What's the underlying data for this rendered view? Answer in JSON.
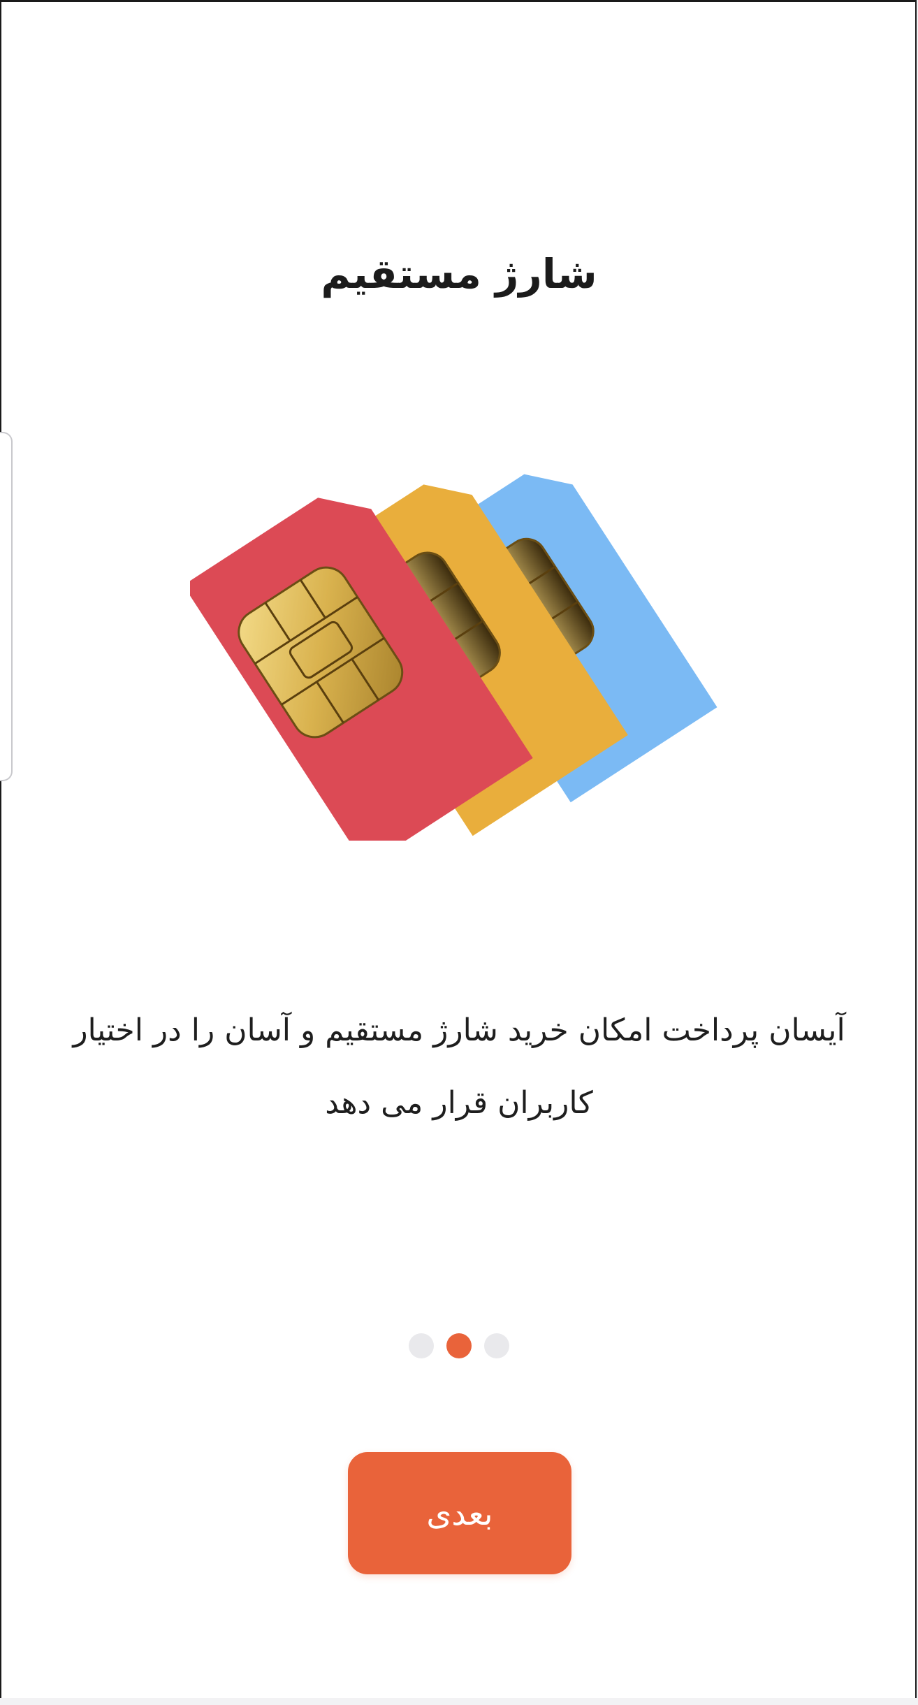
{
  "onboarding": {
    "title": "شارژ مستقیم",
    "description": "آیسان پرداخت امکان خرید شارژ مستقیم و آسان را در اختیار کاربران قرار می دهد",
    "illustration_icon": "sim-cards-icon",
    "pagination": {
      "total": 3,
      "active_index": 1
    },
    "next_label": "بعدی"
  },
  "colors": {
    "accent": "#e9633a",
    "inactive_dot": "#e9e9ec",
    "sim_red": "#dc4a55",
    "sim_yellow": "#e9ae3c",
    "sim_blue": "#7bbaf4",
    "chip_gold": "#e2c064"
  }
}
